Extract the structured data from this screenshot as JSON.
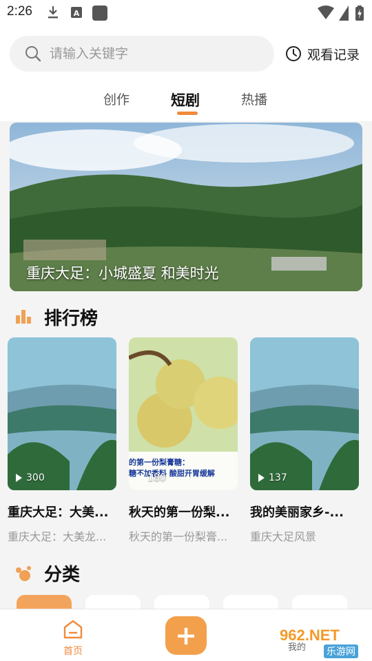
{
  "status_bar": {
    "time": "2:26"
  },
  "header": {
    "search_placeholder": "请输入关键字",
    "history_label": "观看记录",
    "tabs": [
      {
        "label": "创作",
        "active": false
      },
      {
        "label": "短剧",
        "active": true
      },
      {
        "label": "热播",
        "active": false
      }
    ]
  },
  "banner": {
    "caption": "重庆大足：小城盛夏 和美时光"
  },
  "ranking": {
    "title": "排行榜",
    "items": [
      {
        "plays": "300",
        "title": "重庆大足：大美...",
        "subtitle": "重庆大足：大美龙..."
      },
      {
        "plays": "180",
        "title": "秋天的第一份梨...",
        "subtitle": "秋天的第一份梨膏...",
        "overlay_line1": "的第一份梨膏糖：",
        "overlay_line2": "糖不加香料  酸甜开胃缓解"
      },
      {
        "plays": "137",
        "title": "我的美丽家乡-...",
        "subtitle": "重庆大足风景"
      }
    ]
  },
  "category": {
    "title": "分类"
  },
  "bottom_nav": {
    "home_label": "首页",
    "add_label": "+",
    "mine_label": "我的"
  },
  "watermark": {
    "text": "962.NET",
    "sub": "乐游网"
  },
  "colors": {
    "accent": "#f08a3c",
    "fab": "#f3a04d"
  }
}
